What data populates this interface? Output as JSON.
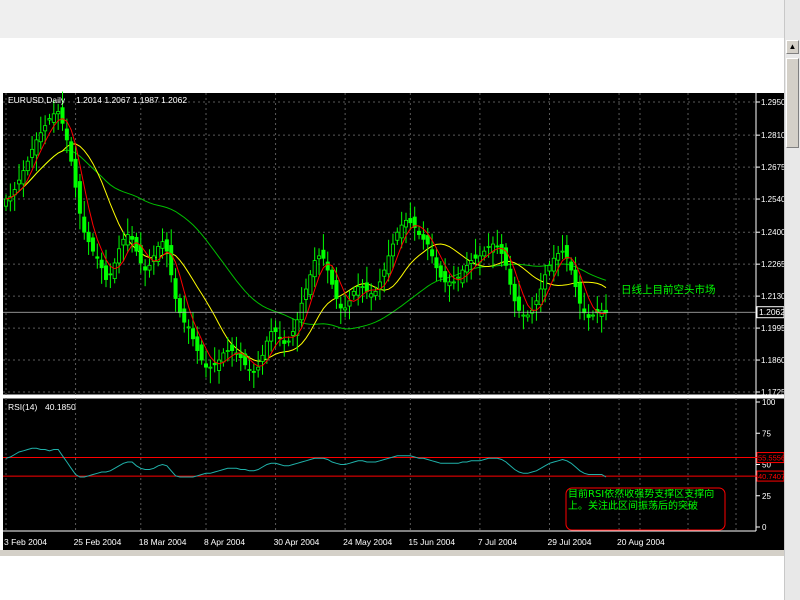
{
  "chart_data": [
    {
      "type": "candlestick",
      "title": "EURUSD,Daily",
      "ohlc_readout": "1.2014 1.2067 1.1987 1.2062",
      "price_tag": "1.2062",
      "current_price": 1.2062,
      "ylim": [
        1.17,
        1.3
      ],
      "y_ticks": [
        "1.2950",
        "1.2810",
        "1.2675",
        "1.2540",
        "1.2400",
        "1.2265",
        "1.2130",
        "1.1995",
        "1.1860",
        "1.1725"
      ],
      "x_ticks": [
        "3 Feb 2004",
        "25 Feb 2004",
        "18 Mar 2004",
        "8 Apr 2004",
        "30 Apr 2004",
        "24 May 2004",
        "15 Jun 2004",
        "7 Jul 2004",
        "29 Jul 2004",
        "20 Aug 2004"
      ],
      "x_tick_index": [
        0,
        16,
        31,
        46,
        62,
        78,
        93,
        109,
        125,
        141
      ],
      "colors": {
        "candle": "#00ff00",
        "ma_fast": "#ff0000",
        "ma_mid": "#ffff00",
        "ma_slow": "#00c000",
        "grid": "#4d4d4d",
        "text": "#ffffff",
        "annotation": "#00ff00"
      },
      "closes": [
        1.254,
        1.255,
        1.258,
        1.262,
        1.266,
        1.27,
        1.275,
        1.279,
        1.282,
        1.285,
        1.288,
        1.29,
        1.291,
        1.286,
        1.279,
        1.27,
        1.259,
        1.248,
        1.24,
        1.236,
        1.232,
        1.229,
        1.225,
        1.22,
        1.222,
        1.227,
        1.233,
        1.237,
        1.239,
        1.237,
        1.232,
        1.227,
        1.224,
        1.226,
        1.23,
        1.234,
        1.236,
        1.232,
        1.222,
        1.212,
        1.206,
        1.202,
        1.2,
        1.195,
        1.19,
        1.186,
        1.183,
        1.183,
        1.184,
        1.186,
        1.189,
        1.19,
        1.19,
        1.189,
        1.187,
        1.184,
        1.182,
        1.181,
        1.183,
        1.188,
        1.194,
        1.198,
        1.198,
        1.195,
        1.193,
        1.194,
        1.198,
        1.203,
        1.21,
        1.216,
        1.222,
        1.228,
        1.23,
        1.229,
        1.224,
        1.218,
        1.212,
        1.208,
        1.208,
        1.211,
        1.215,
        1.217,
        1.217,
        1.215,
        1.214,
        1.215,
        1.219,
        1.224,
        1.23,
        1.235,
        1.24,
        1.243,
        1.245,
        1.244,
        1.242,
        1.239,
        1.237,
        1.235,
        1.23,
        1.225,
        1.221,
        1.219,
        1.219,
        1.219,
        1.221,
        1.224,
        1.226,
        1.228,
        1.229,
        1.23,
        1.232,
        1.234,
        1.235,
        1.234,
        1.231,
        1.226,
        1.218,
        1.211,
        1.207,
        1.205,
        1.205,
        1.207,
        1.211,
        1.216,
        1.222,
        1.226,
        1.229,
        1.231,
        1.232,
        1.229,
        1.224,
        1.217,
        1.21,
        1.206,
        1.204,
        1.205,
        1.206,
        1.207,
        1.206
      ],
      "ma_fast_label": "",
      "ma_mid_label": "",
      "ma_slow_label": "",
      "annotation": "日线上目前空头市场"
    },
    {
      "type": "line",
      "title": "RSI(14)",
      "current_value": "40.1850",
      "ylim": [
        0,
        100
      ],
      "y_ticks": [
        "100",
        "75",
        "50",
        "25",
        "0"
      ],
      "levels": [
        55.5556,
        40.7407
      ],
      "level_labels": [
        "55.5556",
        "40.7407"
      ],
      "level_color": "#ff0000",
      "line_color": "#20b2aa",
      "values": [
        55,
        56,
        58,
        60,
        61,
        62,
        63,
        63,
        62,
        62,
        61,
        62,
        62,
        57,
        52,
        47,
        42,
        40,
        40,
        41,
        42,
        43,
        44,
        44,
        45,
        47,
        49,
        51,
        52,
        52,
        49,
        47,
        46,
        46,
        47,
        49,
        50,
        49,
        45,
        41,
        40,
        40,
        40,
        40,
        41,
        42,
        43,
        43,
        44,
        45,
        46,
        47,
        47,
        47,
        46,
        46,
        45,
        45,
        46,
        48,
        50,
        51,
        51,
        50,
        49,
        49,
        50,
        51,
        52,
        53,
        54,
        55,
        55,
        55,
        54,
        52,
        51,
        50,
        50,
        51,
        52,
        53,
        53,
        52,
        52,
        52,
        53,
        54,
        55,
        56,
        57,
        57,
        57,
        57,
        56,
        55,
        55,
        54,
        53,
        52,
        51,
        51,
        51,
        51,
        51,
        52,
        52,
        53,
        53,
        53,
        54,
        55,
        55,
        55,
        54,
        52,
        49,
        46,
        44,
        43,
        43,
        44,
        45,
        47,
        49,
        51,
        52,
        53,
        54,
        53,
        51,
        48,
        45,
        43,
        42,
        42,
        42,
        42,
        40
      ],
      "annotation": "目前RSI依然收强势支撑区支撑向上。关注此区间振荡后的突破"
    }
  ]
}
